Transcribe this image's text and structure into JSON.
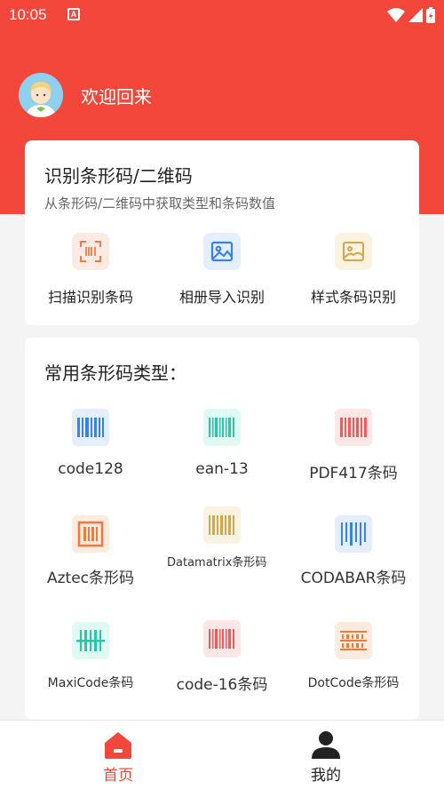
{
  "status_bar": {
    "time": "10:05",
    "notification_letter": "A"
  },
  "header": {
    "welcome_text": "欢迎回来"
  },
  "recognize_card": {
    "title": "识别条形码/二维码",
    "subtitle": "从条形码/二维码中获取类型和条码数值",
    "actions": [
      {
        "label": "扫描识别条码",
        "icon": "scan-barcode-icon",
        "color": "#f07a4a"
      },
      {
        "label": "相册导入识别",
        "icon": "gallery-icon",
        "color": "#3b82e6"
      },
      {
        "label": "样式条码识别",
        "icon": "style-image-icon",
        "color": "#d4a64a"
      }
    ]
  },
  "types_card": {
    "title": "常用条形码类型：",
    "types": [
      {
        "label": "code128",
        "icon": "barcode-icon",
        "color": "#3b82e6"
      },
      {
        "label": "ean-13",
        "icon": "barcode-icon",
        "color": "#2ec4a6"
      },
      {
        "label": "PDF417条码",
        "icon": "barcode-icon",
        "color": "#ef5a5a"
      },
      {
        "label": "Aztec条形码",
        "icon": "barcode-frame-icon",
        "color": "#f07a3a"
      },
      {
        "label": "Datamatrix条形码",
        "icon": "barcode-icon",
        "color": "#d4a64a"
      },
      {
        "label": "CODABAR条码",
        "icon": "barcode-icon",
        "color": "#3b82e6"
      },
      {
        "label": "MaxiCode条码",
        "icon": "barcode-scan-icon",
        "color": "#2ec4a6"
      },
      {
        "label": "code-16条码",
        "icon": "barcode-icon",
        "color": "#ef5a5a"
      },
      {
        "label": "DotCode条形码",
        "icon": "barcode-stack-icon",
        "color": "#f07a3a"
      }
    ]
  },
  "bottom_nav": {
    "items": [
      {
        "label": "首页",
        "icon": "home-icon",
        "active": true
      },
      {
        "label": "我的",
        "icon": "user-icon",
        "active": false
      }
    ]
  },
  "colors": {
    "brand": "#f2473a",
    "background": "#f4f4f4",
    "active_nav": "#f2473a",
    "inactive_nav": "#222222"
  }
}
